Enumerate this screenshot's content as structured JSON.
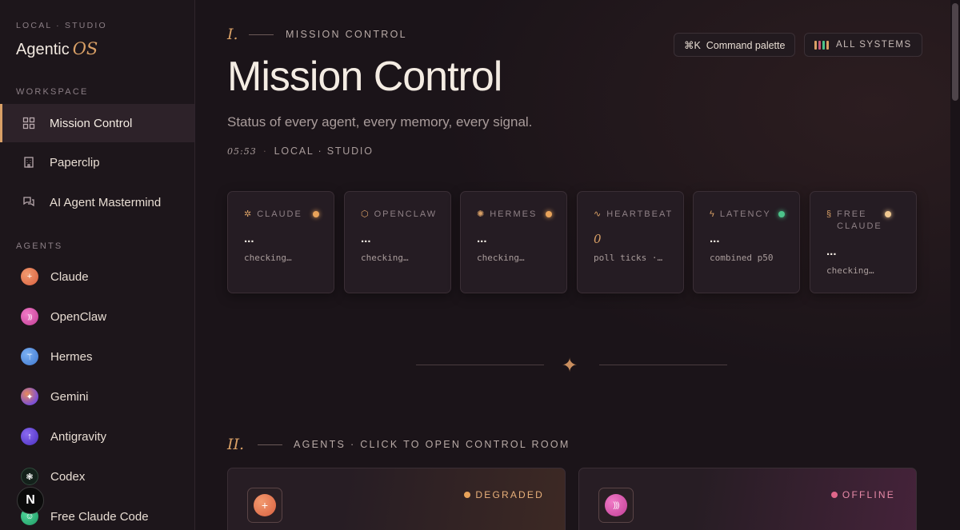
{
  "sidebar": {
    "kicker": "LOCAL · STUDIO",
    "brand": "Agentic",
    "brand_accent": "OS",
    "workspace_label": "WORKSPACE",
    "workspace_items": [
      {
        "label": "Mission Control",
        "icon": "grid-icon",
        "active": true
      },
      {
        "label": "Paperclip",
        "icon": "building-icon"
      },
      {
        "label": "AI Agent Mastermind",
        "icon": "chat-icon"
      }
    ],
    "agents_label": "AGENTS",
    "agents": [
      {
        "label": "Claude",
        "icon": "claude-sparkle-icon",
        "glyph": "+",
        "color": "#e2764f"
      },
      {
        "label": "OpenClaw",
        "icon": "openclaw-waves-icon",
        "glyph": ")))",
        "color": "#d94ea8"
      },
      {
        "label": "Hermes",
        "icon": "hermes-caduceus-icon",
        "glyph": "⚚",
        "color": "#4f8fe0"
      },
      {
        "label": "Gemini",
        "icon": "gemini-star-icon",
        "glyph": "✦",
        "color": "#8a5bd6"
      },
      {
        "label": "Antigravity",
        "icon": "antigravity-arrow-icon",
        "glyph": "↑",
        "color": "#6a42d8"
      },
      {
        "label": "Codex",
        "icon": "codex-knot-icon",
        "glyph": "❃",
        "color": "#1c2a22"
      },
      {
        "label": "Free Claude Code",
        "icon": "free-claude-icon",
        "glyph": "☺",
        "color": "#2bb37a"
      }
    ],
    "badge": "N"
  },
  "header": {
    "section_numeral": "I.",
    "section_kicker": "MISSION CONTROL",
    "title": "Mission Control",
    "subtitle": "Status of every agent, every memory, every signal.",
    "time": "05:53",
    "location": "LOCAL · STUDIO",
    "command_palette": "⌘K  Command palette",
    "systems": "ALL SYSTEMS",
    "system_bar_colors": [
      "#d9a066",
      "#c85a7a",
      "#4cc38a",
      "#d9a066"
    ]
  },
  "status_cards": [
    {
      "label": "CLAUDE",
      "icon": "sparkle-icon",
      "glyph": "✲",
      "value": "...",
      "sub": "checking…",
      "dot": "#e8a35a"
    },
    {
      "label": "OPENCLAW",
      "icon": "cube-icon",
      "glyph": "⬡",
      "value": "...",
      "sub": "checking…",
      "dot": ""
    },
    {
      "label": "HERMES",
      "icon": "gear-icon",
      "glyph": "✺",
      "value": "...",
      "sub": "checking…",
      "dot": "#e8a35a"
    },
    {
      "label": "HEARTBEAT",
      "icon": "pulse-icon",
      "glyph": "∿",
      "value": "0",
      "sub": "poll ticks ·…",
      "dot": ""
    },
    {
      "label": "LATENCY",
      "icon": "bolt-icon",
      "glyph": "ϟ",
      "value": "...",
      "sub": "combined p50",
      "dot": "#4cc38a"
    },
    {
      "label": "FREE CLAUDE",
      "icon": "link-icon",
      "glyph": "§",
      "value": "...",
      "sub": "checking…",
      "dot": "#f0c890"
    }
  ],
  "agents_section": {
    "numeral": "II.",
    "kicker": "AGENTS · CLICK TO OPEN CONTROL ROOM",
    "cards": [
      {
        "status": "DEGRADED",
        "status_color": "#e8a35a",
        "avatar_color": "#e2764f",
        "glyph": "+"
      },
      {
        "status": "OFFLINE",
        "status_color": "#e0668a",
        "avatar_color": "#d94ea8",
        "glyph": ")))"
      }
    ]
  }
}
